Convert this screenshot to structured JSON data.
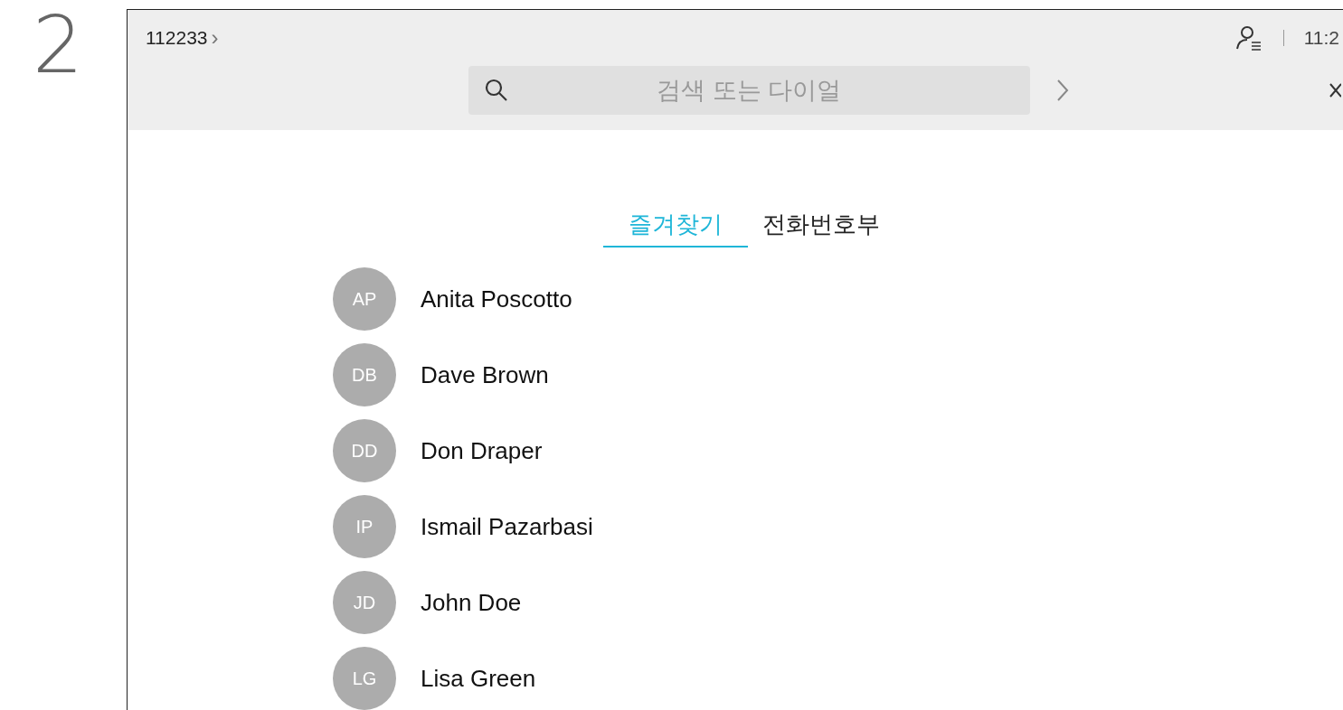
{
  "step_number": "2",
  "header": {
    "breadcrumb": "112233",
    "breadcrumb_chevron": "›",
    "time": "11:2"
  },
  "search": {
    "placeholder": "검색 또는 다이얼"
  },
  "tabs": [
    {
      "label": "즐겨찾기",
      "selected": true
    },
    {
      "label": "전화번호부",
      "selected": false
    }
  ],
  "contacts": [
    {
      "initials": "AP",
      "name": "Anita Poscotto"
    },
    {
      "initials": "DB",
      "name": "Dave Brown"
    },
    {
      "initials": "DD",
      "name": "Don Draper"
    },
    {
      "initials": "IP",
      "name": "Ismail Pazarbasi"
    },
    {
      "initials": "JD",
      "name": "John Doe"
    },
    {
      "initials": "LG",
      "name": "Lisa Green"
    }
  ]
}
